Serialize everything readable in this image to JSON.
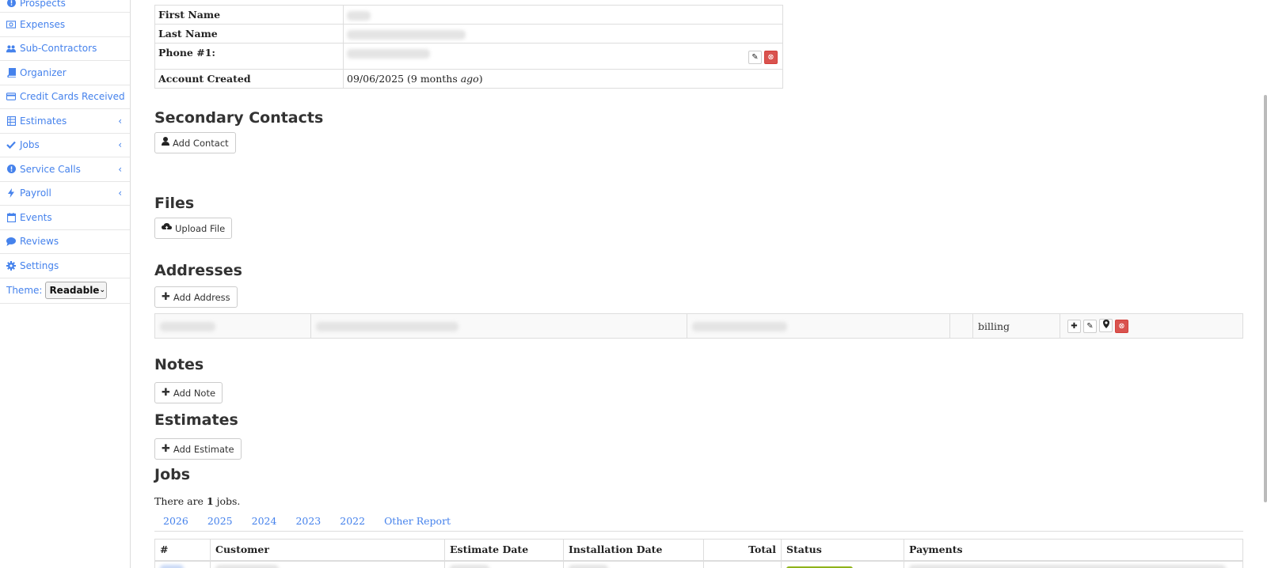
{
  "sidebar": {
    "items": [
      {
        "label": "Prospects",
        "icon": "exclamation-circle-icon",
        "has_chevron": false
      },
      {
        "label": "Expenses",
        "icon": "money-icon",
        "has_chevron": false
      },
      {
        "label": "Sub-Contractors",
        "icon": "users-icon",
        "has_chevron": false
      },
      {
        "label": "Organizer",
        "icon": "book-icon",
        "has_chevron": false
      },
      {
        "label": "Credit Cards Received",
        "icon": "credit-card-icon",
        "has_chevron": false
      },
      {
        "label": "Estimates",
        "icon": "table-icon",
        "has_chevron": true
      },
      {
        "label": "Jobs",
        "icon": "check-icon",
        "has_chevron": true
      },
      {
        "label": "Service Calls",
        "icon": "exclamation-circle-icon",
        "has_chevron": true
      },
      {
        "label": "Payroll",
        "icon": "bolt-icon",
        "has_chevron": true
      },
      {
        "label": "Events",
        "icon": "calendar-icon",
        "has_chevron": false
      },
      {
        "label": "Reviews",
        "icon": "comment-icon",
        "has_chevron": false
      },
      {
        "label": "Settings",
        "icon": "gear-icon",
        "has_chevron": false
      }
    ],
    "theme_label": "Theme:",
    "theme_value": "Readable"
  },
  "contact": {
    "first_name_label": "First Name",
    "last_name_label": "Last Name",
    "phone_label": "Phone #1:",
    "account_created_label": "Account Created",
    "account_created_value": "09/06/2025 (9 months ",
    "account_created_ago": "ago",
    "account_created_close": ")"
  },
  "sections": {
    "secondary_contacts": "Secondary Contacts",
    "add_contact": "Add Contact",
    "files": "Files",
    "upload_file": "Upload File",
    "addresses": "Addresses",
    "add_address": "Add Address",
    "notes": "Notes",
    "add_note": "Add Note",
    "estimates": "Estimates",
    "add_estimate": "Add Estimate",
    "jobs": "Jobs"
  },
  "address_row": {
    "type": "billing"
  },
  "jobs": {
    "count_prefix": "There are ",
    "count": "1",
    "count_suffix": " jobs.",
    "year_tabs": [
      "2026",
      "2025",
      "2024",
      "2023",
      "2022",
      "Other Report"
    ],
    "columns": [
      "#",
      "Customer",
      "Estimate Date",
      "Installation Date",
      "Total",
      "Status",
      "Payments"
    ]
  },
  "colors": {
    "link": "#4582ec",
    "danger": "#d9534f",
    "status_green": "#8fb31a"
  }
}
